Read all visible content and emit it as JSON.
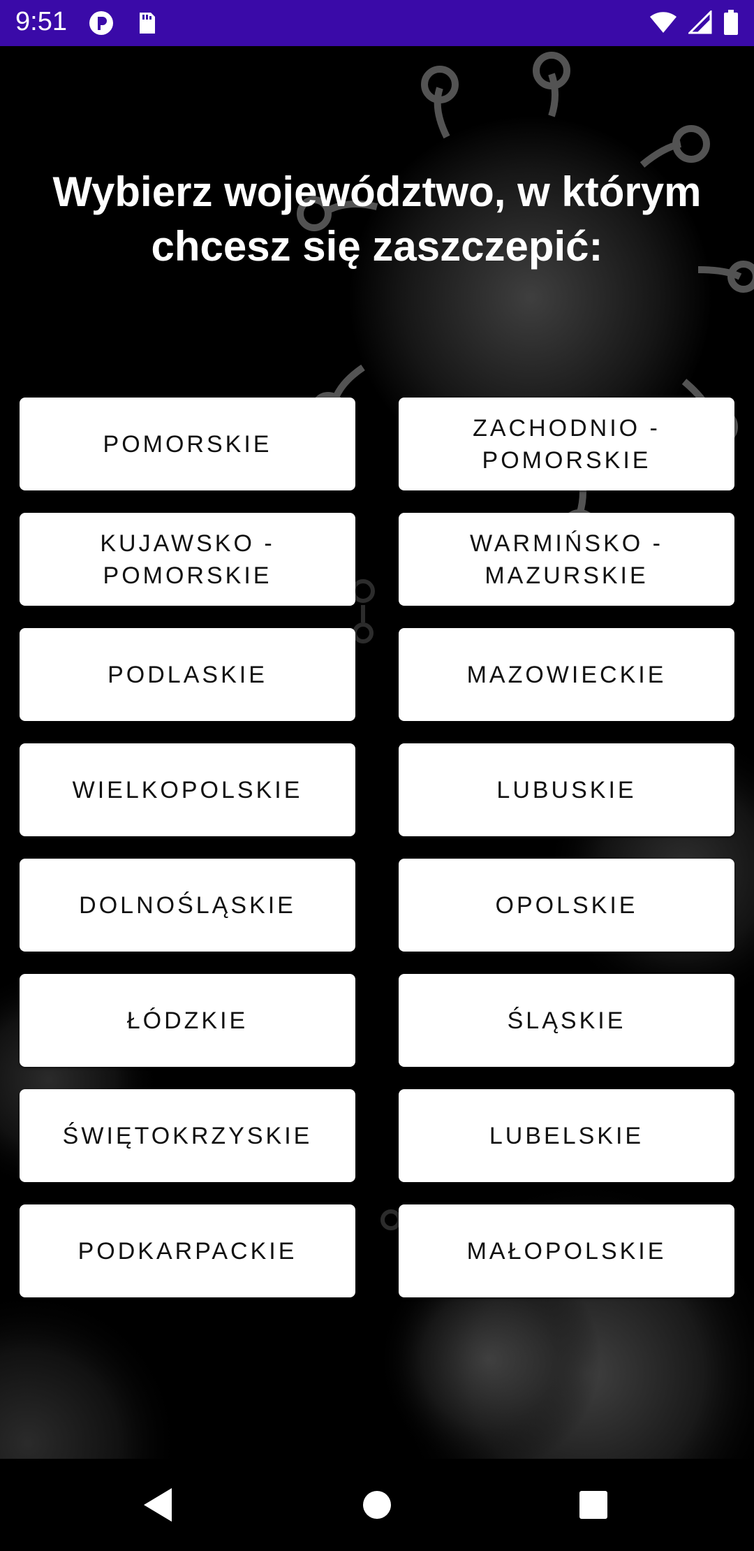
{
  "status_bar": {
    "time": "9:51",
    "left_icons": [
      "app-notification-icon",
      "sd-card-icon"
    ],
    "right_icons": [
      "wifi-icon",
      "cell-signal-icon",
      "battery-icon"
    ],
    "background_color": "#3a0aa8"
  },
  "screen": {
    "title": "Wybierz województwo, w którym chcesz się zaszczepić:",
    "background_color": "#000000"
  },
  "regions": [
    {
      "label": "POMORSKIE"
    },
    {
      "label": "ZACHODNIO -\nPOMORSKIE"
    },
    {
      "label": "KUJAWSKO -\nPOMORSKIE"
    },
    {
      "label": "WARMIŃSKO -\nMAZURSKIE"
    },
    {
      "label": "PODLASKIE"
    },
    {
      "label": "MAZOWIECKIE"
    },
    {
      "label": "WIELKOPOLSKIE"
    },
    {
      "label": "LUBUSKIE"
    },
    {
      "label": "DOLNOŚLĄSKIE"
    },
    {
      "label": "OPOLSKIE"
    },
    {
      "label": "ŁÓDZKIE"
    },
    {
      "label": "ŚLĄSKIE"
    },
    {
      "label": "ŚWIĘTOKRZYSKIE"
    },
    {
      "label": "LUBELSKIE"
    },
    {
      "label": "PODKARPACKIE"
    },
    {
      "label": "MAŁOPOLSKIE"
    }
  ],
  "nav_bar": {
    "buttons": [
      "back-icon",
      "home-icon",
      "recents-icon"
    ]
  }
}
